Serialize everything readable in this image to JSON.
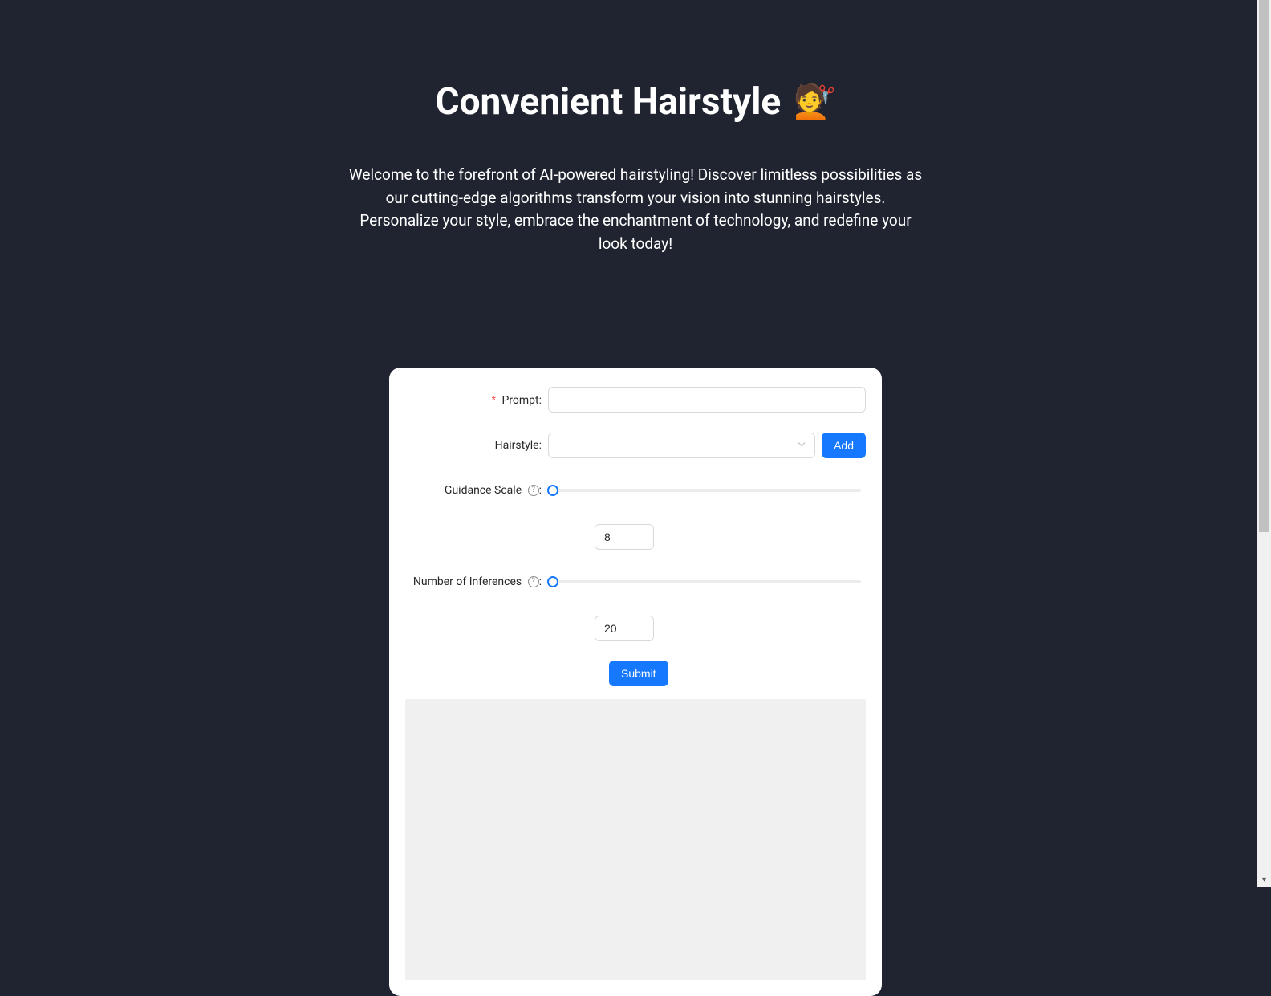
{
  "header": {
    "title": "Convenient Hairstyle",
    "emoji": "💇",
    "description": "Welcome to the forefront of AI-powered hairstyling! Discover limitless possibilities as our cutting-edge algorithms transform your vision into stunning hairstyles. Personalize your style, embrace the enchantment of technology, and redefine your look today!"
  },
  "form": {
    "prompt": {
      "label": "Prompt",
      "value": "",
      "required": true
    },
    "hairstyle": {
      "label": "Hairstyle",
      "value": "",
      "add_button": "Add"
    },
    "guidance_scale": {
      "label": "Guidance Scale",
      "value": "8",
      "slider_position": 0
    },
    "num_inferences": {
      "label": "Number of Inferences",
      "value": "20",
      "slider_position": 0
    },
    "submit_button": "Submit"
  },
  "colors": {
    "background": "#1f2430",
    "primary": "#1677ff",
    "text_light": "#ffffff"
  }
}
